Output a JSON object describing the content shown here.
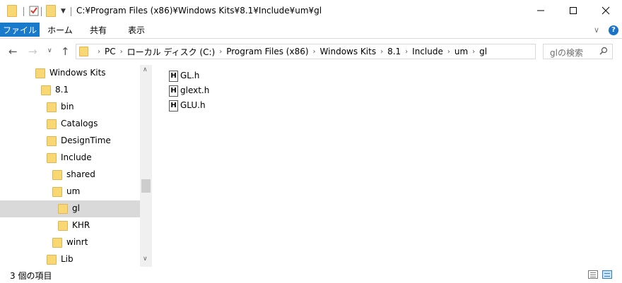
{
  "titlebar": {
    "path_title": "C:¥Program Files (x86)¥Windows Kits¥8.1¥Include¥um¥gl",
    "minimize_icon": "minimize-icon",
    "maximize_icon": "maximize-icon",
    "close_icon": "close-icon"
  },
  "ribbon": {
    "tabs": [
      {
        "label": "ファイル"
      },
      {
        "label": "ホーム"
      },
      {
        "label": "共有"
      },
      {
        "label": "表示"
      }
    ],
    "help_glyph": "?",
    "accent_color": "#1979ca"
  },
  "navigation": {
    "crumbs": [
      "PC",
      "ローカル ディスク (C:)",
      "Program Files (x86)",
      "Windows Kits",
      "8.1",
      "Include",
      "um",
      "gl"
    ],
    "search_placeholder": "glの検索"
  },
  "tree": {
    "items": [
      {
        "label": "Windows Kits"
      },
      {
        "label": "8.1"
      },
      {
        "label": "bin"
      },
      {
        "label": "Catalogs"
      },
      {
        "label": "DesignTime"
      },
      {
        "label": "Include"
      },
      {
        "label": "shared"
      },
      {
        "label": "um"
      },
      {
        "label": "gl",
        "selected": true
      },
      {
        "label": "KHR"
      },
      {
        "label": "winrt"
      },
      {
        "label": "Lib"
      }
    ]
  },
  "files": {
    "items": [
      {
        "label": "GL.h",
        "icon_glyph": "H"
      },
      {
        "label": "glext.h",
        "icon_glyph": "H"
      },
      {
        "label": "GLU.h",
        "icon_glyph": "H"
      }
    ]
  },
  "status": {
    "item_count": "3 個の項目"
  }
}
